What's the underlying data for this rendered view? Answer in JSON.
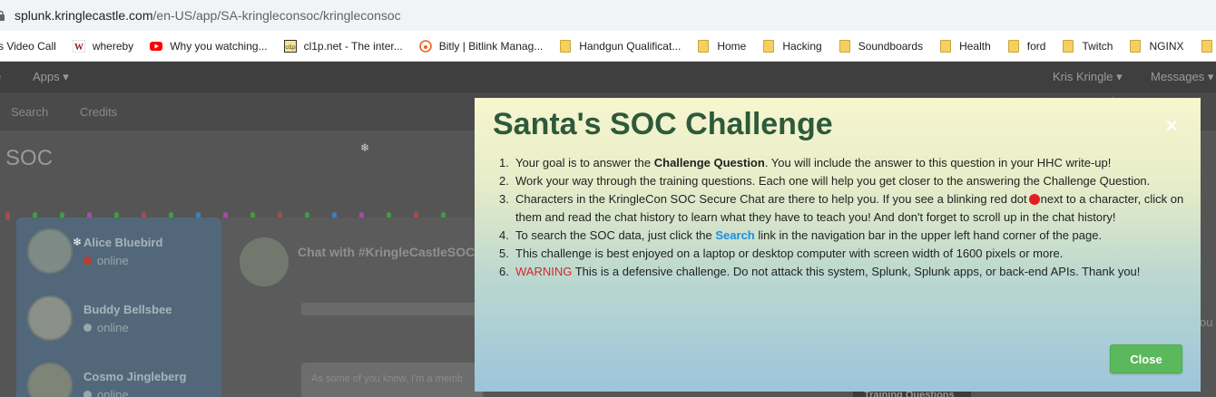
{
  "browser": {
    "url_host": "splunk.kringlecastle.com",
    "url_path": "/en-US/app/SA-kringleconsoc/kringleconsoc"
  },
  "bookmarks": [
    {
      "label": "s Video Call",
      "icon": "none"
    },
    {
      "label": "whereby",
      "icon": "whereby-icon"
    },
    {
      "label": "Why you watching...",
      "icon": "youtube-icon"
    },
    {
      "label": "cl1p.net - The inter...",
      "icon": "cl1p-icon"
    },
    {
      "label": "Bitly | Bitlink Manag...",
      "icon": "bitly-icon"
    },
    {
      "label": "Handgun Qualificat...",
      "icon": "folder-icon"
    },
    {
      "label": "Home",
      "icon": "folder-icon"
    },
    {
      "label": "Hacking",
      "icon": "folder-icon"
    },
    {
      "label": "Soundboards",
      "icon": "folder-icon"
    },
    {
      "label": "Health",
      "icon": "folder-icon"
    },
    {
      "label": "ford",
      "icon": "folder-icon"
    },
    {
      "label": "Twitch",
      "icon": "folder-icon"
    },
    {
      "label": "NGINX",
      "icon": "folder-icon"
    }
  ],
  "appbar": {
    "left_glyph": "e",
    "apps_label": "Apps ▾",
    "user_label": "Kris Kringle ▾",
    "messages_label": "Messages ▾"
  },
  "navbar": {
    "search_label": "Search",
    "credits_label": "Credits"
  },
  "page": {
    "title_fragment": "e SOC"
  },
  "contacts": [
    {
      "name": "Alice Bluebird",
      "status": "online",
      "status_color": "#c0392b"
    },
    {
      "name": "Buddy Bellsbee",
      "status": "online",
      "status_color": "#9aa6ae"
    },
    {
      "name": "Cosmo Jingleberg",
      "status": "online",
      "status_color": "#9aa6ae"
    }
  ],
  "chat": {
    "title": "Chat with #KringleCastleSOC",
    "message_snippet": "As some of you know, I'm a memb",
    "right_edge_text": "ou",
    "training_label": "Training Questions"
  },
  "modal": {
    "title": "Santa's SOC Challenge",
    "close_x": "×",
    "items": [
      {
        "num": "1.",
        "pre": "Your goal is to answer the ",
        "bold": "Challenge Question",
        "post": ". You will include the answer to this question in your HHC write-up!"
      },
      {
        "num": "2.",
        "text": "Work your way through the training questions. Each one will help you get closer to the answering the Challenge Question."
      },
      {
        "num": "3.",
        "pre": "Characters in the KringleCon SOC Secure Chat are there to help you. If you see a blinking red dot",
        "post": "next to a character, click on them and read the chat history to learn what they have to teach you! And don't forget to scroll up in the chat history!"
      },
      {
        "num": "4.",
        "pre": "To search the SOC data, just click the ",
        "link": "Search",
        "post": " link in the navigation bar in the upper left hand corner of the page."
      },
      {
        "num": "5.",
        "text": "This challenge is best enjoyed on a laptop or desktop computer with screen width of 1600 pixels or more."
      },
      {
        "num": "6.",
        "warn": "WARNING",
        "post": " This is a defensive challenge. Do not attack this system, Splunk, Splunk apps, or back-end APIs. Thank you!"
      }
    ],
    "close_label": "Close"
  },
  "colors": {
    "modal_title": "#2d5a3a",
    "link": "#1a8fe0",
    "warning": "#d8262c",
    "close_button": "#5cb85c"
  }
}
